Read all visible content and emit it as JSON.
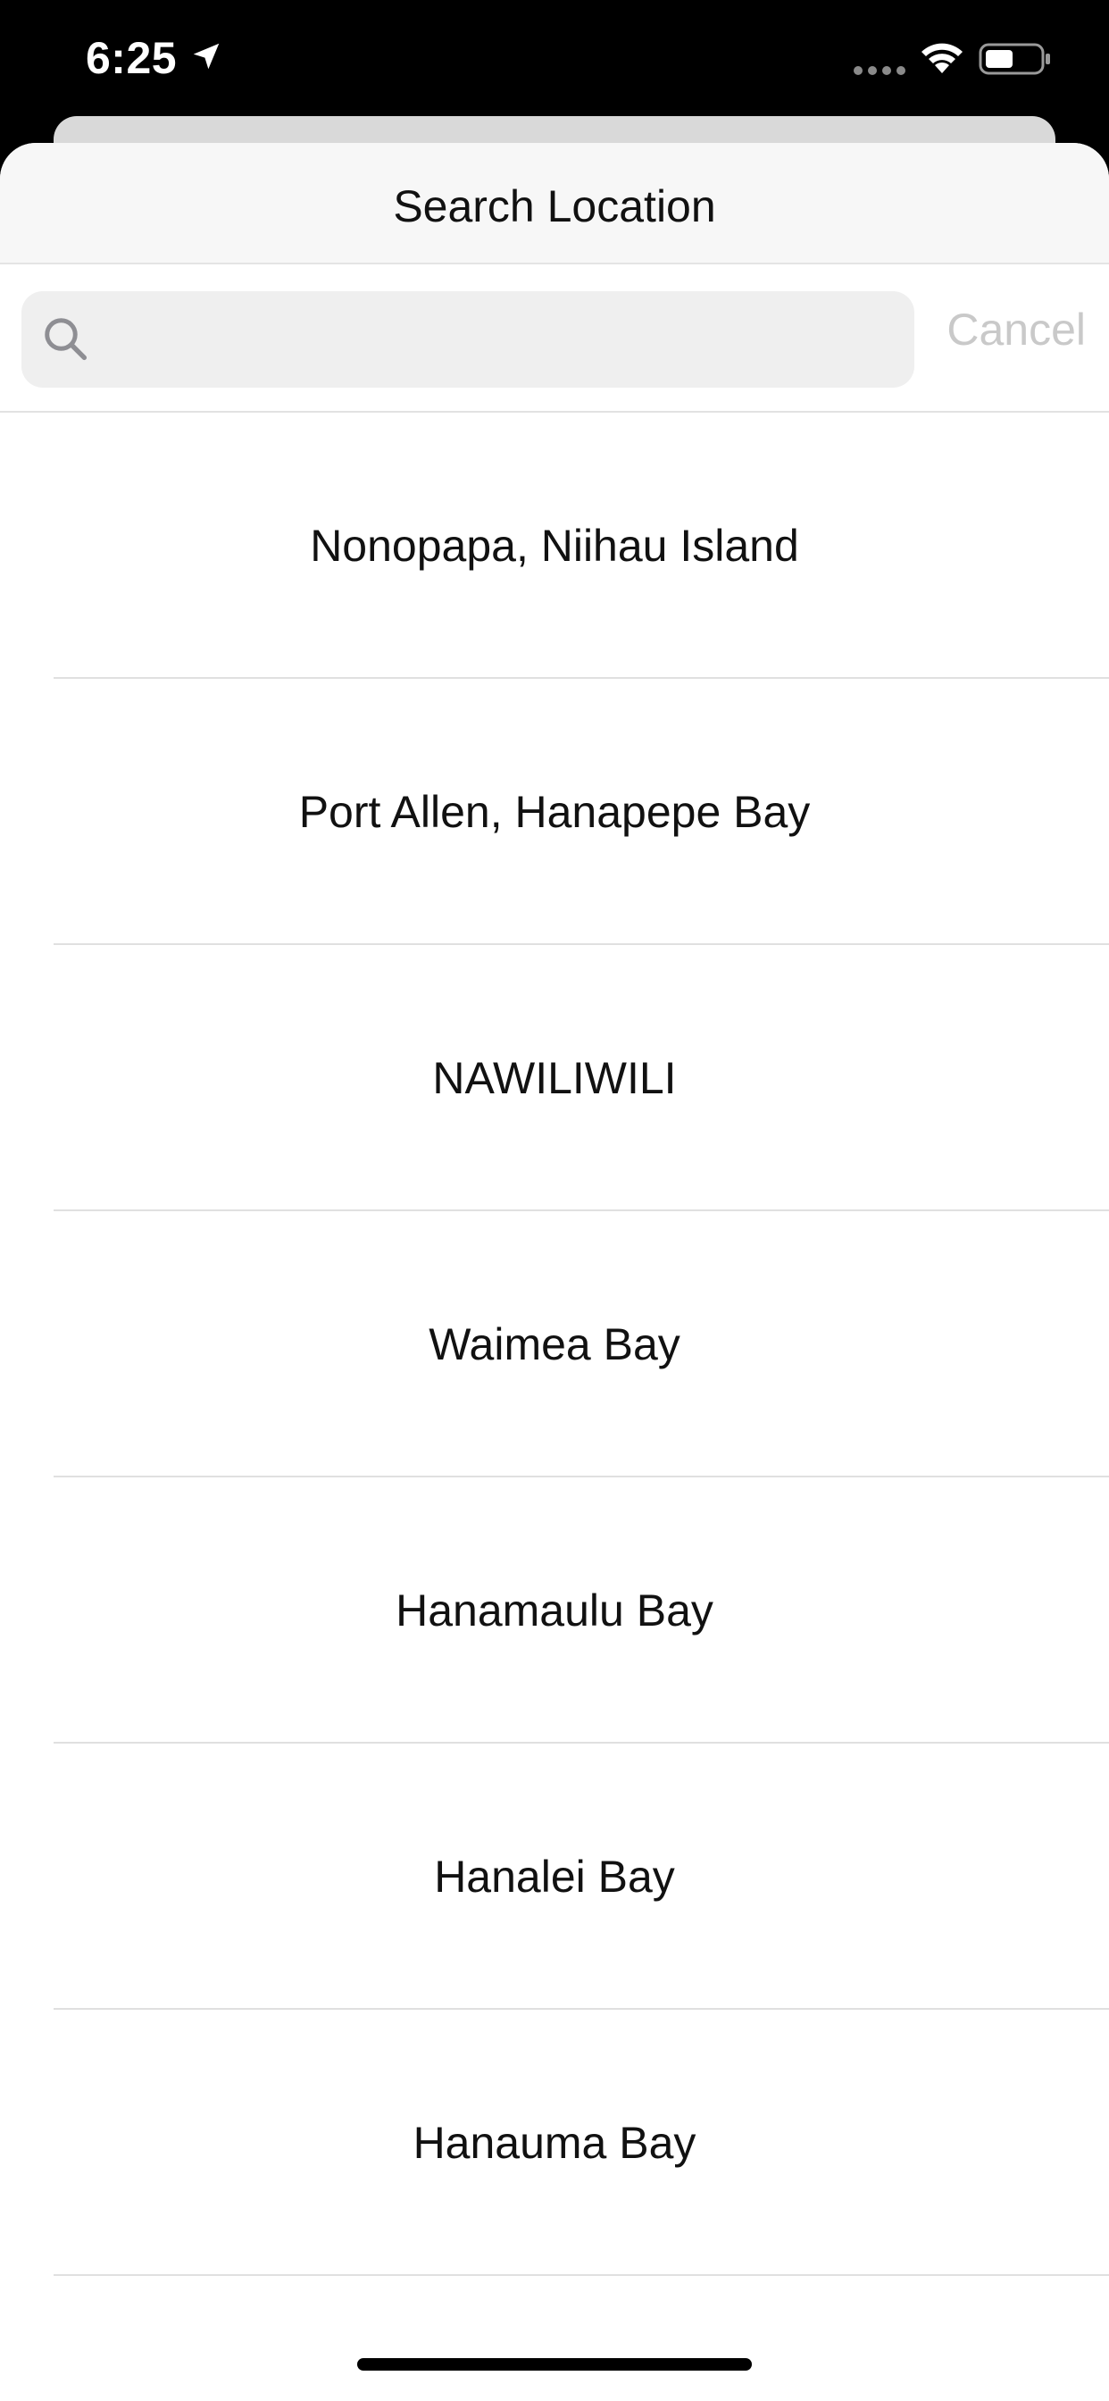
{
  "status_bar": {
    "time": "6:25"
  },
  "sheet": {
    "title": "Search Location"
  },
  "search": {
    "value": "",
    "placeholder": "",
    "cancel_label": "Cancel"
  },
  "locations": [
    {
      "label": "Nonopapa, Niihau Island"
    },
    {
      "label": "Port Allen, Hanapepe Bay"
    },
    {
      "label": "NAWILIWILI"
    },
    {
      "label": "Waimea Bay"
    },
    {
      "label": "Hanamaulu Bay"
    },
    {
      "label": "Hanalei Bay"
    },
    {
      "label": "Hanauma Bay"
    }
  ],
  "colors": {
    "cancel_text": "#c9c9c9",
    "search_field_bg": "#efefef",
    "header_bg": "#f7f7f7"
  }
}
